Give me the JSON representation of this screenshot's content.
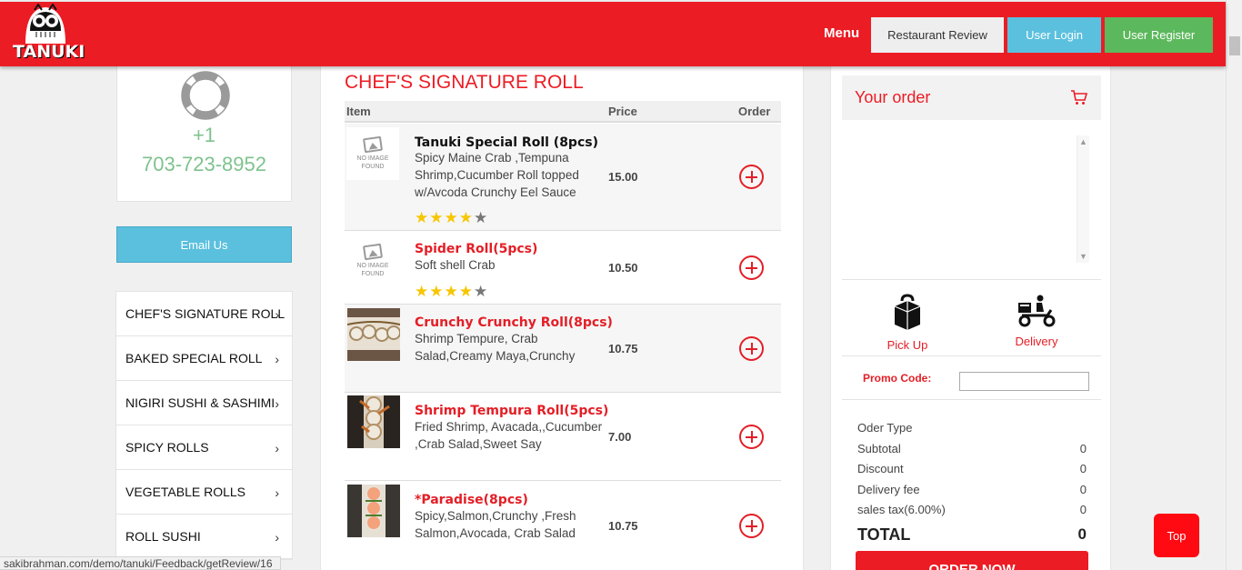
{
  "header": {
    "logo_text": "TANUKI",
    "menu_label": "Menu",
    "buttons": {
      "review": "Restaurant Review",
      "login": "User Login",
      "register": "User Register"
    }
  },
  "contact": {
    "phone_plus": "+1",
    "phone_number": "703-723-8952",
    "email_button": "Email Us"
  },
  "categories": [
    "CHEF'S SIGNATURE ROLL",
    "BAKED SPECIAL ROLL",
    "NIGIRI SUSHI & SASHIMI",
    "SPICY ROLLS",
    "VEGETABLE ROLLS",
    "ROLL SUSHI"
  ],
  "menu": {
    "section_title": "CHEF'S SIGNATURE ROLL",
    "columns": {
      "item": "Item",
      "price": "Price",
      "order": "Order"
    },
    "no_image_text": [
      "NO IMAGE",
      "FOUND"
    ],
    "items": [
      {
        "name": "Tanuki Special Roll (8pcs)",
        "desc": "Spicy Maine Crab ,Tempuna Shrimp,Cucumber Roll topped w/Avcoda Crunchy Eel Sauce",
        "price": "15.00",
        "rating": 4
      },
      {
        "name": "Spider Roll(5pcs)",
        "desc": "Soft shell Crab",
        "price": "10.50",
        "rating": 4
      },
      {
        "name": "Crunchy Crunchy Roll(8pcs)",
        "desc": "Shrimp Tempure, Crab Salad,Creamy Maya,Crunchy",
        "price": "10.75"
      },
      {
        "name": "Shrimp Tempura Roll(5pcs)",
        "desc": "Fried Shrimp, Avacada,,Cucumber ,Crab Salad,Sweet Say",
        "price": "7.00"
      },
      {
        "name": "*Paradise(8pcs)",
        "desc": "Spicy,Salmon,Crunchy ,Fresh Salmon,Avocada, Crab Salad",
        "price": "10.75"
      }
    ]
  },
  "order": {
    "title": "Your order",
    "pickup_label": "Pick Up",
    "delivery_label": "Delivery",
    "promo_label": "Promo Code:",
    "summary": {
      "order_type": "Oder Type",
      "subtotal": "Subtotal",
      "subtotal_value": "0",
      "discount": "Discount",
      "discount_value": "0",
      "delivery_fee": "Delivery fee",
      "delivery_fee_value": "0",
      "sales_tax": "sales tax(6.00%)",
      "sales_tax_value": "0",
      "total": "TOTAL",
      "total_value": "0"
    },
    "order_now": "ORDER NOW"
  },
  "top_button": "Top",
  "status_url": "sakibrahman.com/demo/tanuki/Feedback/getReview/16",
  "colors": {
    "brand_red": "#ec1c24",
    "info_blue": "#5bc0de",
    "success_green": "#5cb85c",
    "phone_green": "#7ec38e",
    "star_gold": "#f7c600"
  }
}
